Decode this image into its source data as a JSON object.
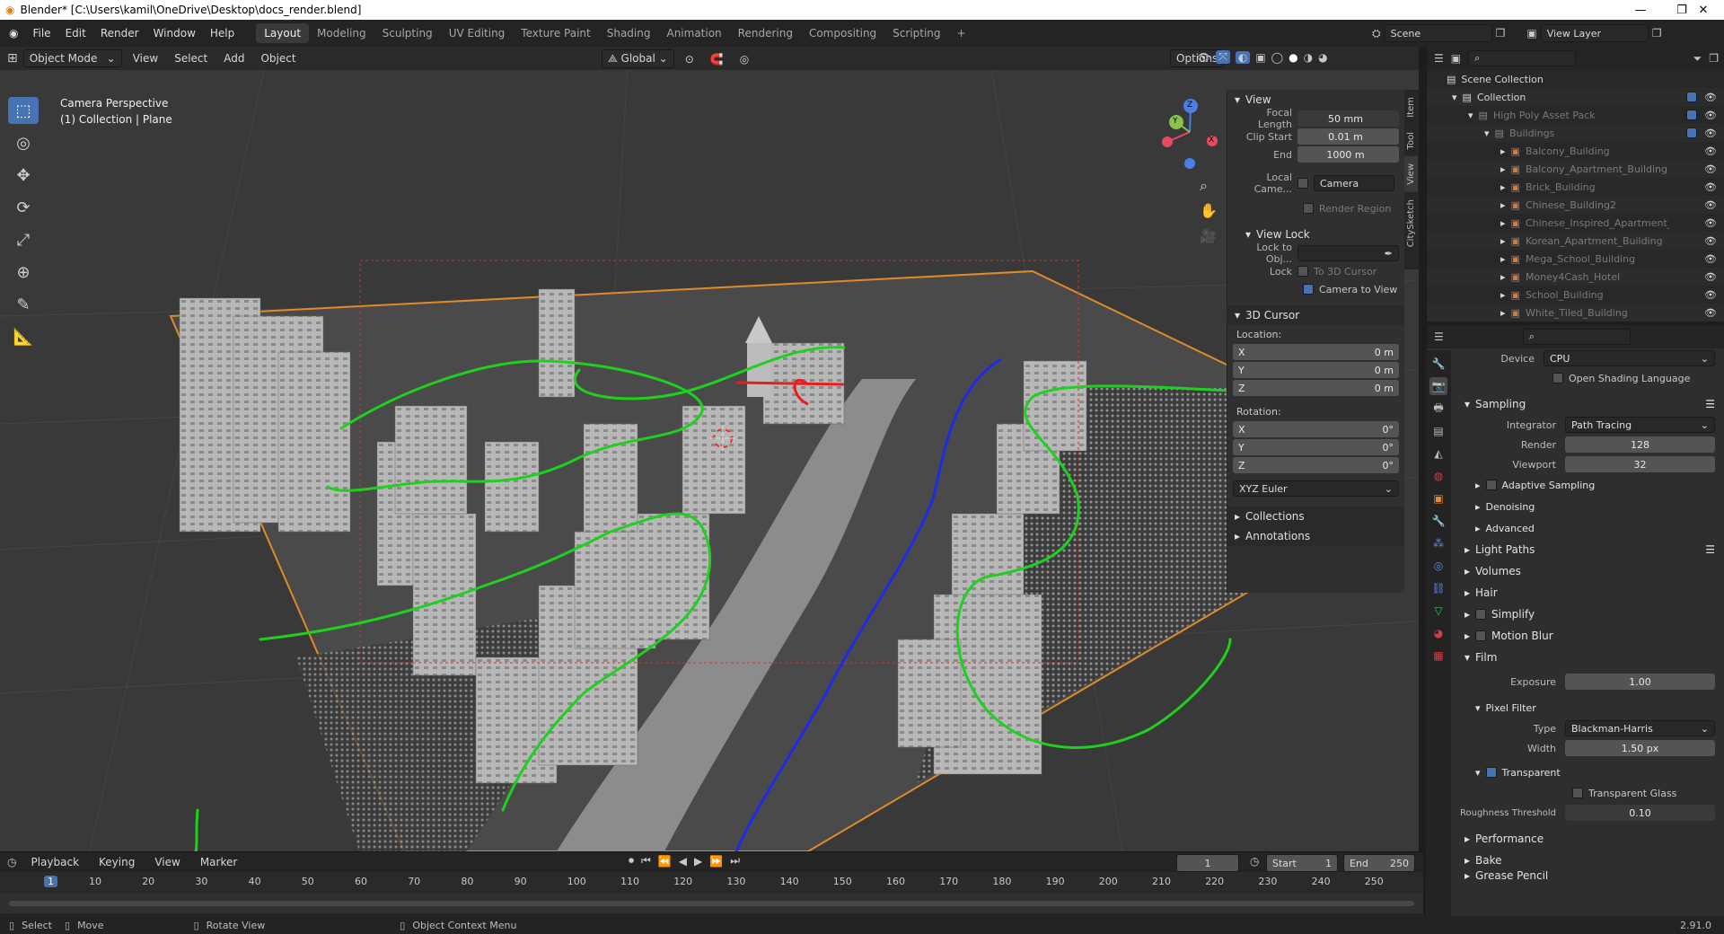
{
  "titlebar": {
    "title": "Blender* [C:\\Users\\kamil\\OneDrive\\Desktop\\docs_render.blend]",
    "minimize": "—",
    "maximize": "❐",
    "close": "✕"
  },
  "topbar": {
    "menus": [
      "File",
      "Edit",
      "Render",
      "Window",
      "Help"
    ],
    "workspaces": [
      "Layout",
      "Modeling",
      "Sculpting",
      "UV Editing",
      "Texture Paint",
      "Shading",
      "Animation",
      "Rendering",
      "Compositing",
      "Scripting"
    ],
    "add_tab": "+",
    "scene": "Scene",
    "view_layer": "View Layer"
  },
  "viewport": {
    "mode": "Object Mode",
    "menus": [
      "View",
      "Select",
      "Add",
      "Object"
    ],
    "transform": "Global",
    "options": "Options",
    "camera_label": "Camera Perspective",
    "collection_label": "(1) Collection | Plane",
    "gizmo": {
      "x": "X",
      "y": "Y",
      "z": "Z"
    }
  },
  "npanel": {
    "tabs": [
      "Item",
      "Tool",
      "View",
      "CitySketch"
    ],
    "view_title": "View",
    "focal_label": "Focal Length",
    "focal_value": "50 mm",
    "clip_start_label": "Clip Start",
    "clip_start_value": "0.01 m",
    "end_label": "End",
    "end_value": "1000 m",
    "local_camera_label": "Local Came...",
    "local_camera_value": "Camera",
    "render_region": "Render Region",
    "view_lock_title": "View Lock",
    "lock_obj_label": "Lock to Obj...",
    "lock_label": "Lock",
    "to_3d_cursor": "To 3D Cursor",
    "camera_to_view": "Camera to View",
    "cursor_title": "3D Cursor",
    "location_label": "Location:",
    "loc": [
      {
        "axis": "X",
        "v": "0 m"
      },
      {
        "axis": "Y",
        "v": "0 m"
      },
      {
        "axis": "Z",
        "v": "0 m"
      }
    ],
    "rotation_label": "Rotation:",
    "rot": [
      {
        "axis": "X",
        "v": "0°"
      },
      {
        "axis": "Y",
        "v": "0°"
      },
      {
        "axis": "Z",
        "v": "0°"
      }
    ],
    "rotation_mode": "XYZ Euler",
    "collections": "Collections",
    "annotations": "Annotations"
  },
  "outliner": {
    "search_placeholder": "",
    "scene_collection": "Scene Collection",
    "collection": "Collection",
    "asset_pack": "High Poly Asset Pack",
    "buildings": "Buildings",
    "items": [
      "Balcony_Building",
      "Balcony_Apartment_Building",
      "Brick_Building",
      "Chinese_Building2",
      "Chinese_Inspired_Apartment_Bu",
      "Korean_Apartment_Building",
      "Mega_School_Building",
      "Money4Cash_Hotel",
      "School_Building",
      "White_Tiled_Building"
    ]
  },
  "properties": {
    "device_label": "Device",
    "device_value": "CPU",
    "osl": "Open Shading Language",
    "sampling": "Sampling",
    "integrator_label": "Integrator",
    "integrator_value": "Path Tracing",
    "render_label": "Render",
    "render_value": "128",
    "viewport_label": "Viewport",
    "viewport_value": "32",
    "adaptive": "Adaptive Sampling",
    "denoising": "Denoising",
    "advanced": "Advanced",
    "light_paths": "Light Paths",
    "volumes": "Volumes",
    "hair": "Hair",
    "simplify": "Simplify",
    "motion_blur": "Motion Blur",
    "film": "Film",
    "exposure_label": "Exposure",
    "exposure_value": "1.00",
    "pixel_filter": "Pixel Filter",
    "type_label": "Type",
    "type_value": "Blackman-Harris",
    "width_label": "Width",
    "width_value": "1.50 px",
    "transparent": "Transparent",
    "transparent_glass": "Transparent Glass",
    "roughness_label": "Roughness Threshold",
    "roughness_value": "0.10",
    "performance": "Performance",
    "bake": "Bake",
    "grease": "Grease Pencil"
  },
  "timeline": {
    "menus": [
      "Playback",
      "Keying",
      "View",
      "Marker"
    ],
    "current_frame": "1",
    "start_label": "Start",
    "start_value": "1",
    "end_label": "End",
    "end_value": "250",
    "ticks": [
      "1",
      "10",
      "20",
      "30",
      "40",
      "50",
      "60",
      "70",
      "80",
      "90",
      "100",
      "110",
      "120",
      "130",
      "140",
      "150",
      "160",
      "170",
      "180",
      "190",
      "200",
      "210",
      "220",
      "230",
      "240",
      "250"
    ]
  },
  "statusbar": {
    "select": "Select",
    "move": "Move",
    "rotate": "Rotate View",
    "context": "Object Context Menu",
    "version": "2.91.0"
  }
}
